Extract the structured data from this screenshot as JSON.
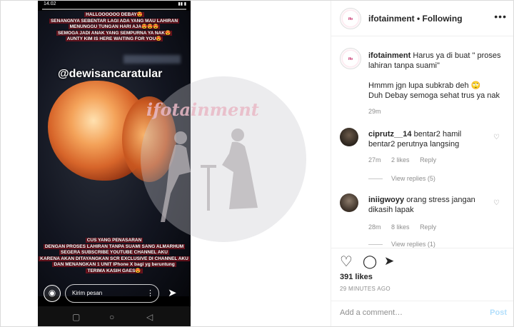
{
  "story": {
    "status_time": "14.02",
    "caption_top": [
      "HALLOOOOOO DEBAY😍",
      "SENANGNYA SEBENTAR LAGI ADA YANG MAU LAHIRAN",
      "MENUNGGU TUNGAN HARI AJA😍😍😍",
      "SEMOGA JADI ANAK YANG SEMPURNA YA NAK😍",
      "AUNTY KIM IS HERE WAITING FOR YOU😍"
    ],
    "mention": "@dewisancaratular",
    "caption_bottom": [
      "CUS YANG PENASARAN",
      "DENGAN PROSES LAHIRAN TANPA SUAMI SANG ALMARHUM",
      "SEGERA SUBSCRIBE YOUTUBE CHANNEL AKU",
      "KARENA AKAN DITAYANGKAN SCR EXCLUSIVE DI CHANNEL AKU",
      "DAN MENANGKAN 1 UNIT IPhone X bagi yg beruntung",
      "TERIMA KASIH GAES😍"
    ],
    "reply_placeholder": "Kirim pesan",
    "watermark": "ifotainment"
  },
  "header": {
    "username": "ifotainment",
    "separator": " • ",
    "follow_label": "Following",
    "more": "•••"
  },
  "caption": {
    "username": "ifotainment",
    "text": "Harus ya di buat \" proses lahiran tanpa suami\"",
    "line2": "Hmmm jgn lupa subkrab deh 🙄",
    "line3": "Duh Debay semoga sehat trus ya nak",
    "time": "29m"
  },
  "comments": [
    {
      "username": "ciprutz__14",
      "text": "bentar2 hamil bentar2 perutnya langsing",
      "time": "27m",
      "likes": "2 likes",
      "reply": "Reply",
      "view_replies": "View replies (5)"
    },
    {
      "username": "iniigwoyy",
      "text": "orang stress jangan dikasih lapak",
      "time": "28m",
      "likes": "8 likes",
      "reply": "Reply",
      "view_replies": "View replies (1)"
    }
  ],
  "post": {
    "likes": "391 likes",
    "time_ago": "29 MINUTES AGO",
    "comment_placeholder": "Add a comment…",
    "post_label": "Post"
  },
  "icons": {
    "heart": "♡",
    "comment": "◯",
    "share": "➤",
    "camera": "◉",
    "send": "➤",
    "more_vertical": "⋮"
  },
  "colors": {
    "link_blue": "#b2dffc",
    "meta_gray": "#8e8e8e",
    "text": "#262626"
  }
}
